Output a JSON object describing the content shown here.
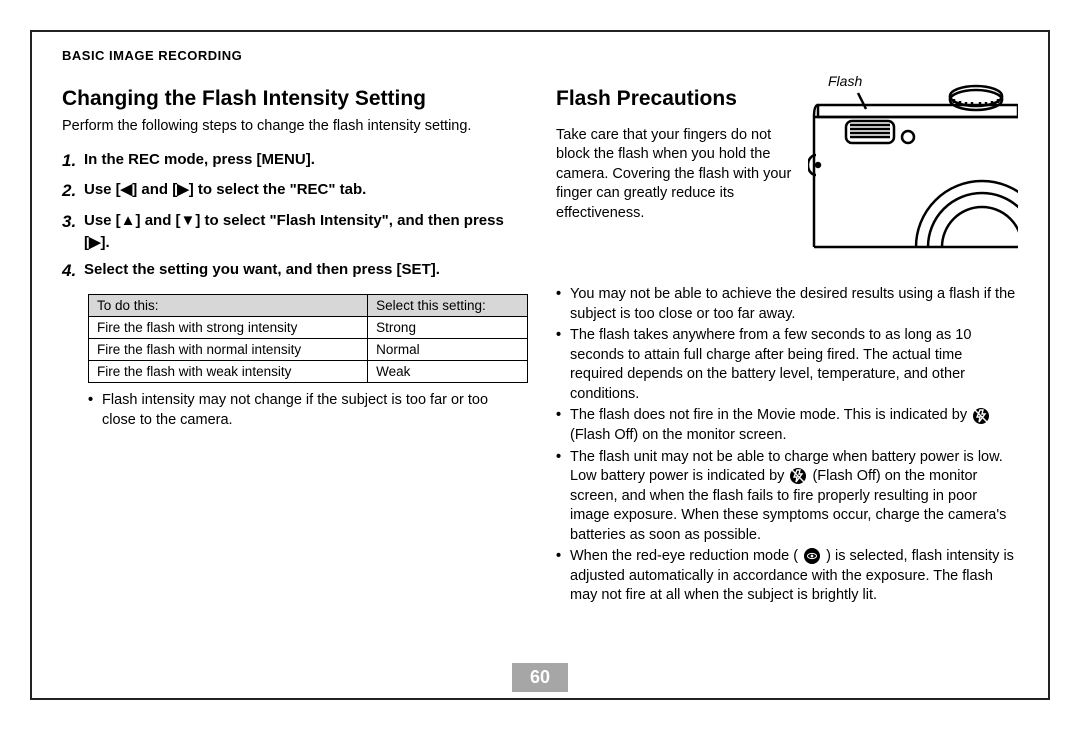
{
  "section": "BASIC IMAGE RECORDING",
  "left": {
    "heading": "Changing the Flash Intensity Setting",
    "intro": "Perform the following steps to change the flash intensity setting.",
    "steps": [
      "In the REC mode, press [MENU].",
      "Use [◀] and [▶] to select the \"REC\" tab.",
      "Use [▲] and [▼] to select \"Flash Intensity\", and then press [▶].",
      "Select the setting you want, and then press [SET]."
    ],
    "table": {
      "headers": [
        "To do this:",
        "Select this setting:"
      ],
      "rows": [
        [
          "Fire the flash with strong intensity",
          "Strong"
        ],
        [
          "Fire the flash with normal intensity",
          "Normal"
        ],
        [
          "Fire the flash with weak intensity",
          "Weak"
        ]
      ]
    },
    "note": "Flash intensity may not change if the subject is too far or too close to the camera."
  },
  "right": {
    "heading": "Flash Precautions",
    "intro": "Take care that your fingers do not block the flash when you hold the camera. Covering the flash with your finger can greatly reduce its effectiveness.",
    "figure_label": "Flash",
    "bullets": {
      "b1": "You may not be able to achieve the desired results using a flash if the subject is too close or too far away.",
      "b2": "The flash takes anywhere from a few seconds to as long as 10 seconds to attain full charge after being fired. The actual time required depends on the battery level, temperature, and other conditions.",
      "b3a": "The flash does not fire in the Movie mode. This is indicated by ",
      "b3b": " (Flash Off) on the monitor screen.",
      "b4a": "The flash unit may not be able to charge when battery power is low. Low battery power is indicated by ",
      "b4b": " (Flash Off) on the monitor screen, and when the flash fails to fire properly resulting in poor image exposure. When these symptoms occur, charge the camera's batteries as soon as possible.",
      "b5a": "When the red-eye reduction mode (",
      "b5b": ") is selected, flash intensity is adjusted automatically in accordance with the exposure. The flash may not fire at all when the subject is brightly lit."
    }
  },
  "page_number": "60"
}
